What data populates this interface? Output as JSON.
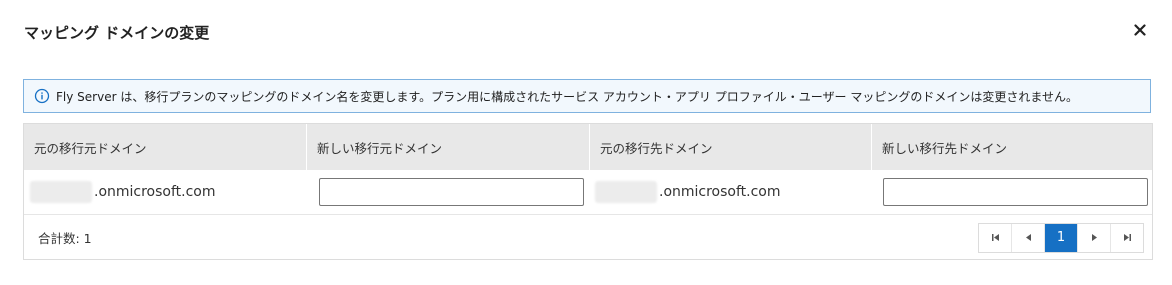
{
  "dialog": {
    "title": "マッピング ドメインの変更",
    "close_icon": "close-icon"
  },
  "info": {
    "icon": "info-icon",
    "message": "Fly Server は、移行プランのマッピングのドメイン名を変更します。プラン用に構成されたサービス アカウント・アプリ プロファイル・ユーザー マッピングのドメインは変更されません。"
  },
  "table": {
    "headers": [
      "元の移行元ドメイン",
      "新しい移行元ドメイン",
      "元の移行先ドメイン",
      "新しい移行先ドメイン"
    ],
    "rows": [
      {
        "source_domain": ".onmicrosoft.com",
        "new_source_domain": "",
        "target_domain": ".onmicrosoft.com",
        "new_target_domain": ""
      }
    ]
  },
  "footer": {
    "total_label": "合計数: 1"
  },
  "pagination": {
    "first_icon": "first-page-icon",
    "prev_icon": "prev-page-icon",
    "current_page": "1",
    "next_icon": "next-page-icon",
    "last_icon": "last-page-icon"
  },
  "colors": {
    "accent": "#1670c4",
    "info_border": "#7fb2df",
    "info_bg": "#f2f8fd",
    "header_bg": "#e8e8e8"
  }
}
